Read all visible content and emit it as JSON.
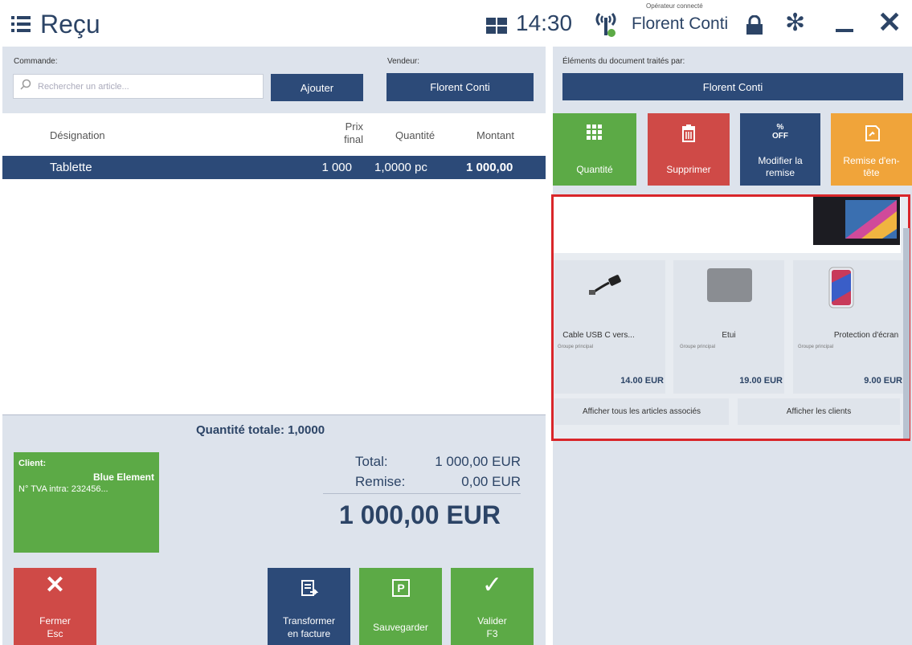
{
  "header": {
    "title": "Reçu",
    "clock": "14:30",
    "operator_caption": "Opérateur connecté",
    "operator_name": "Florent Conti"
  },
  "order": {
    "label": "Commande:",
    "search_placeholder": "Rechercher un article...",
    "add_button": "Ajouter",
    "seller_label": "Vendeur:",
    "seller_name": "Florent Conti"
  },
  "table": {
    "headers": {
      "designation": "Désignation",
      "price_line1": "Prix",
      "price_line2": "final",
      "quantity": "Quantité",
      "amount": "Montant"
    },
    "rows": [
      {
        "designation": "Tablette",
        "price": "1 000",
        "quantity": "1,0000 pc",
        "amount": "1 000,00"
      }
    ]
  },
  "summary": {
    "total_qty": "Quantité totale: 1,0000",
    "total_label": "Total:",
    "total_value": "1 000,00 EUR",
    "discount_label": "Remise:",
    "discount_value": "0,00 EUR",
    "grand_total": "1 000,00 EUR"
  },
  "client": {
    "label": "Client:",
    "name": "Blue Element",
    "vat": "N° TVA intra: 232456..."
  },
  "bottom_actions": {
    "close_line1": "Fermer",
    "close_line2": "Esc",
    "invoice_line1": "Transformer",
    "invoice_line2": "en facture",
    "save": "Sauvegarder",
    "validate_line1": "Valider",
    "validate_line2": "F3"
  },
  "right_panel": {
    "processed_by_label": "Éléments du document traités par:",
    "processed_by_name": "Florent Conti",
    "tiles": {
      "quantity": "Quantité",
      "delete": "Supprimer",
      "discount_badge_1": "%",
      "discount_badge_2": "OFF",
      "discount_line1": "Modifier la",
      "discount_line2": "remise",
      "header_discount_line1": "Remise d'en-",
      "header_discount_line2": "tête"
    }
  },
  "associated": {
    "products": [
      {
        "name": "Cable USB C vers...",
        "group": "Groupe principal",
        "price": "14.00 EUR"
      },
      {
        "name": "Etui",
        "group": "Groupe principal",
        "price": "19.00 EUR"
      },
      {
        "name": "Protection d'écran",
        "group": "Groupe principal",
        "price": "9.00 EUR"
      }
    ],
    "show_all_button": "Afficher tous les articles associés",
    "show_clients_button": "Afficher les clients"
  },
  "icons": [
    "menu-icon",
    "grid-icon",
    "signal-icon",
    "lock-icon",
    "config-icon",
    "minimize-icon",
    "close-icon",
    "search-icon",
    "keypad-icon",
    "trash-icon",
    "discount-icon",
    "header-discount-icon",
    "close-x-icon",
    "invoice-icon",
    "parking-icon",
    "check-icon"
  ],
  "colors": {
    "navy": "#2c4a78",
    "green": "#5caa46",
    "red": "#cf4a47",
    "orange": "#f0a43a",
    "highlight_border": "#d9262a",
    "panel_bg": "#dde3ec"
  }
}
